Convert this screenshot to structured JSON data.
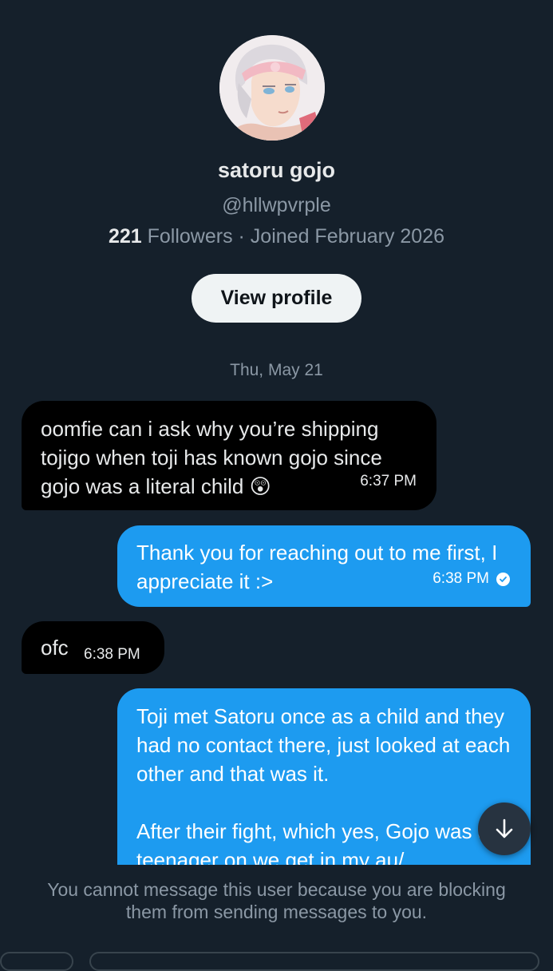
{
  "profile": {
    "display_name": "satoru gojo",
    "handle": "@hllwpvrple",
    "followers_count": "221",
    "followers_label": " Followers · Joined February 2026",
    "view_profile_label": "View profile"
  },
  "conversation": {
    "date_separator": "Thu, May 21",
    "messages": [
      {
        "direction": "incoming",
        "text": "oomfie can i ask why you’re shipping tojigo when toji has known gojo since gojo was a literal child 😲",
        "time": "6:37 PM"
      },
      {
        "direction": "outgoing",
        "text": "Thank you for reaching out to me first, I appreciate it :>",
        "time": "6:38 PM",
        "status_icon": "read-check-icon"
      },
      {
        "direction": "incoming",
        "text": "ofc",
        "time": "6:38 PM"
      },
      {
        "direction": "outgoing",
        "text": "Toji met Satoru once as a child and they had no contact there, just looked at each other and that was it.\n\nAfter their fight, which yes, Gojo was a teenager on we get in my au/"
      }
    ]
  },
  "footer": {
    "blocked_notice": "You cannot message this user because you are blocking them from sending messages to you."
  },
  "icons": {
    "scroll_down": "arrow-down-icon",
    "read_status": "check-circle-icon"
  },
  "colors": {
    "background": "#15202b",
    "incoming_bubble": "#000000",
    "outgoing_bubble": "#1d9bf0",
    "secondary_text": "#8b98a5",
    "button_bg": "#eff3f4"
  }
}
